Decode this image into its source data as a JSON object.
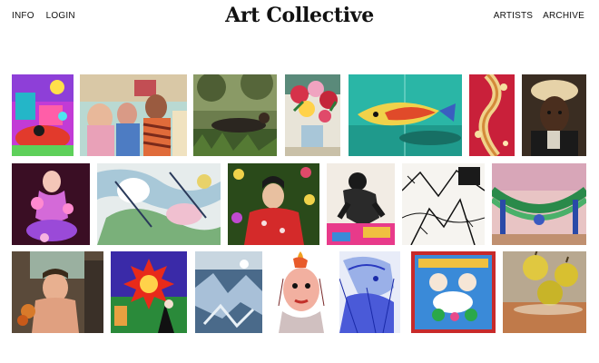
{
  "header": {
    "left_links": [
      "INFO",
      "LOGIN"
    ],
    "title": "Art Collective",
    "right_links": [
      "ARTISTS",
      "ARCHIVE"
    ]
  },
  "gallery": {
    "rows": [
      [
        {
          "subject": "colorful surreal candy landscape"
        },
        {
          "subject": "group of people painting"
        },
        {
          "subject": "person lying in grass"
        },
        {
          "subject": "flowers in vase still life"
        },
        {
          "subject": "fish over teal sea"
        },
        {
          "subject": "vertical red pattern with figure"
        },
        {
          "subject": "portrait with hat"
        }
      ],
      [
        {
          "subject": "pink purple sculpture figure"
        },
        {
          "subject": "abstract pastel brushstrokes"
        },
        {
          "subject": "woman among flowers"
        },
        {
          "subject": "black and white figure drawing"
        },
        {
          "subject": "line drawing landscape"
        },
        {
          "subject": "drapery with green garland"
        }
      ],
      [
        {
          "subject": "child in car interior"
        },
        {
          "subject": "red sun with cartoon figures"
        },
        {
          "subject": "icy blue abstract"
        },
        {
          "subject": "drawn face with flame hair"
        },
        {
          "subject": "blue line portrait"
        },
        {
          "subject": "framed figures with flowers"
        },
        {
          "subject": "apples still life"
        }
      ]
    ]
  }
}
